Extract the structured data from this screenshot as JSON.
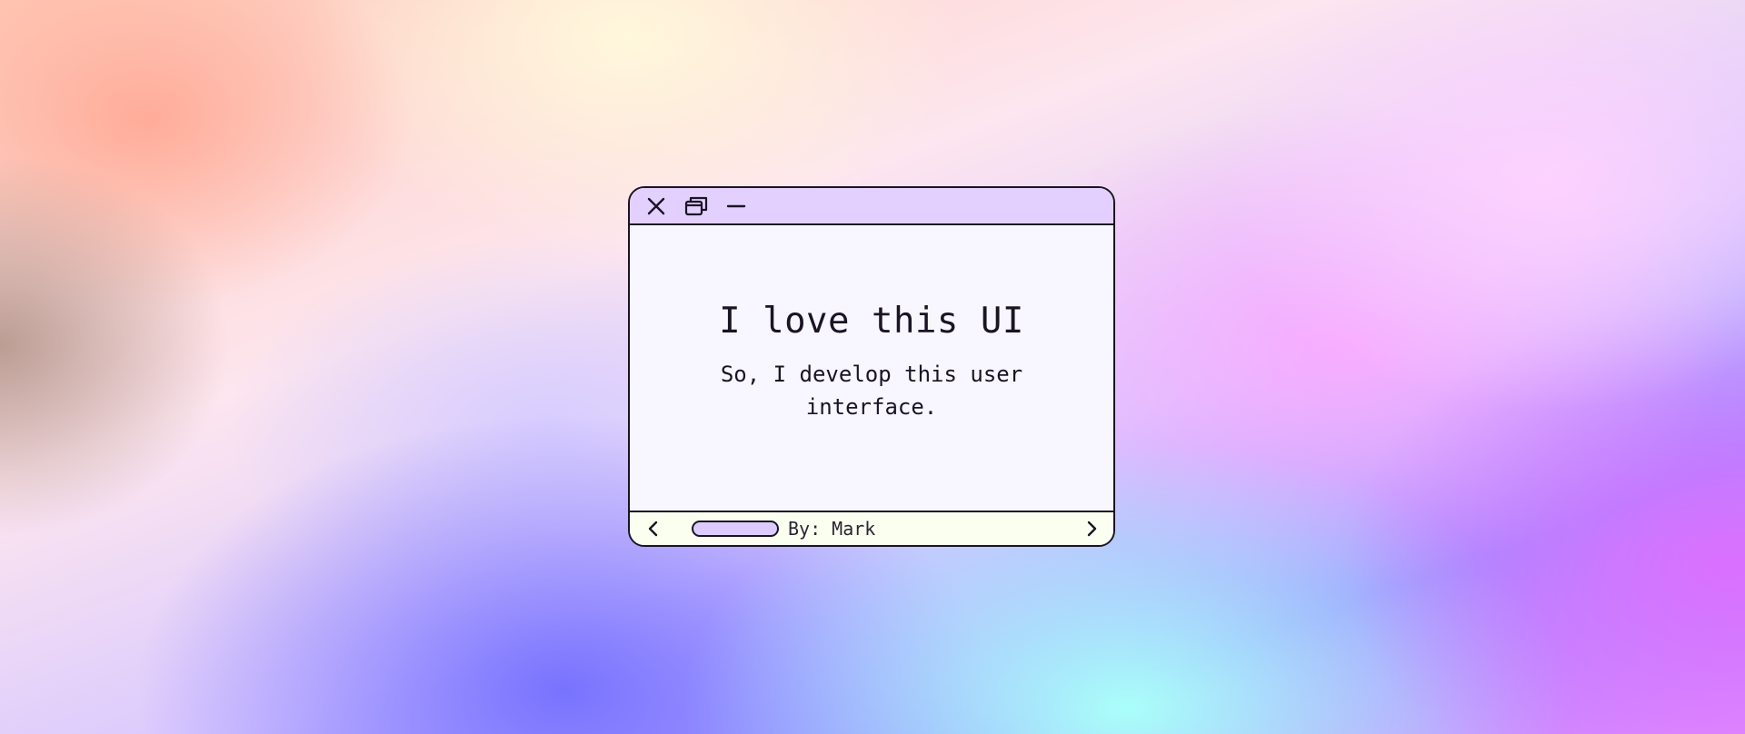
{
  "window": {
    "title_buttons": [
      {
        "icon": "close-icon"
      },
      {
        "icon": "restore-icon"
      },
      {
        "icon": "minimize-icon"
      }
    ]
  },
  "content": {
    "headline": "I love this UI",
    "subtext": "So, I develop this user interface."
  },
  "footer": {
    "author": "By: Mark",
    "prev_icon": "chevron-left-icon",
    "next_icon": "chevron-right-icon"
  },
  "colors": {
    "titlebar": "#e3d0ff",
    "content_bg": "#f8f7ff",
    "footer_bg": "#fbfff0",
    "pill": "#dccbff",
    "border": "#1a1424"
  }
}
